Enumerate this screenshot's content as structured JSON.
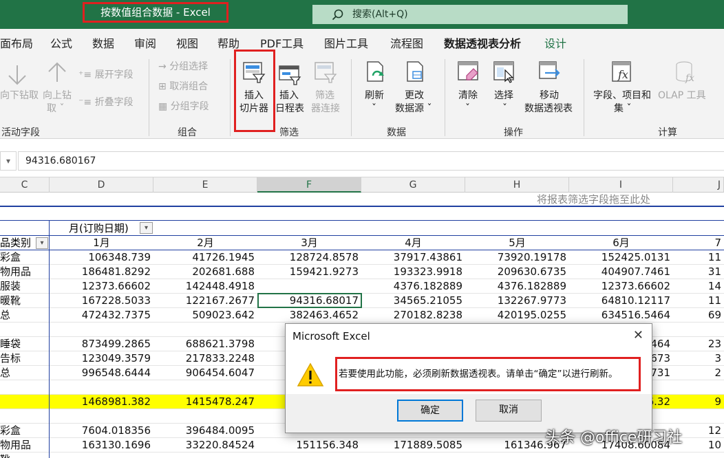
{
  "title": "按数值组合数据 - Excel",
  "search": {
    "placeholder": "搜索(Alt+Q)"
  },
  "tabs": [
    "面布局",
    "公式",
    "数据",
    "审阅",
    "视图",
    "帮助",
    "PDF工具",
    "图片工具",
    "流程图",
    "数据透视表分析",
    "设计"
  ],
  "ribbon": {
    "drill_down": "向下钻取",
    "drill_up_1": "向上钻",
    "drill_up_2": "取 ˇ",
    "expand_field": "展开字段",
    "collapse_field": "折叠字段",
    "group_active": "活动字段",
    "group_selection": "分组选择",
    "ungroup": "取消组合",
    "group_field": "分组字段",
    "group_group": "组合",
    "insert_slicer_1": "插入",
    "insert_slicer_2": "切片器",
    "insert_timeline_1": "插入",
    "insert_timeline_2": "日程表",
    "filter_conn_1": "筛选",
    "filter_conn_2": "器连接",
    "group_filter": "筛选",
    "refresh_1": "刷新",
    "refresh_2": "ˇ",
    "change_source_1": "更改",
    "change_source_2": "数据源 ˇ",
    "group_data": "数据",
    "clear_1": "清除",
    "clear_2": "ˇ",
    "select_1": "选择",
    "select_2": "ˇ",
    "move_1": "移动",
    "move_2": "数据透视表",
    "group_actions": "操作",
    "fields_1": "字段、项目和",
    "fields_2": "集 ˇ",
    "olap": "OLAP 工具",
    "group_calc": "计算"
  },
  "formula_value": "94316.680167",
  "columns": [
    "C",
    "D",
    "E",
    "F",
    "G",
    "H",
    "I",
    "J"
  ],
  "drop_hint": "将报表筛选字段拖至此处",
  "pivot": {
    "col_field": "月(订购日期)",
    "row_field": "品类别",
    "months": [
      "1月",
      "2月",
      "3月",
      "4月",
      "5月",
      "6月",
      "7"
    ],
    "rows": [
      {
        "label": "彩盒",
        "vals": [
          "106348.739",
          "41726.1945",
          "128724.8578",
          "37917.43861",
          "73920.19178",
          "152425.0131",
          "11"
        ]
      },
      {
        "label": "物用品",
        "vals": [
          "186481.8292",
          "202681.688",
          "159421.9273",
          "193323.9918",
          "209630.6735",
          "404907.7461",
          "31"
        ]
      },
      {
        "label": "服装",
        "vals": [
          "12373.66602",
          "142448.4918",
          "",
          "4376.182889",
          "4376.182889",
          "12373.66602",
          "14"
        ]
      },
      {
        "label": "暖靴",
        "vals": [
          "167228.5033",
          "122167.2677",
          "94316.68017",
          "34565.21055",
          "132267.9773",
          "64810.12117",
          "11"
        ]
      },
      {
        "label": "总",
        "vals": [
          "472432.7375",
          "509023.642",
          "382463.4652",
          "270182.8238",
          "420195.0255",
          "634516.5464",
          "69"
        ]
      },
      {
        "label": "",
        "vals": [
          "",
          "",
          "",
          "",
          "",
          "",
          ""
        ]
      },
      {
        "label": "睡袋",
        "vals": [
          "873499.2865",
          "688621.3798",
          "",
          "",
          "",
          "464",
          "23"
        ]
      },
      {
        "label": "告标",
        "vals": [
          "123049.3579",
          "217833.2248",
          "",
          "",
          "",
          "673",
          "3"
        ]
      },
      {
        "label": "总",
        "vals": [
          "996548.6444",
          "906454.6047",
          "",
          "",
          "",
          "731",
          "2"
        ]
      },
      {
        "label": "",
        "vals": [
          "",
          "",
          "",
          "",
          "",
          "",
          ""
        ]
      },
      {
        "label": "",
        "vals": [
          "1468981.382",
          "1415478.247",
          "",
          "",
          "",
          "6.32",
          "9"
        ]
      },
      {
        "label": "",
        "vals": [
          "",
          "",
          "",
          "",
          "",
          "",
          ""
        ]
      },
      {
        "label": "彩盒",
        "vals": [
          "7604.018356",
          "396484.0095",
          "",
          "",
          "",
          "",
          "12"
        ]
      },
      {
        "label": "物用品",
        "vals": [
          "163130.1696",
          "33220.84524",
          "151156.348",
          "171889.5085",
          "161346.967",
          "17408.60084",
          "10"
        ]
      },
      {
        "label": "靴",
        "vals": [
          "",
          "",
          "",
          "",
          "",
          "",
          ""
        ]
      }
    ]
  },
  "dialog": {
    "title": "Microsoft Excel",
    "message": "若要使用此功能，必须刷新数据透视表。请单击“确定”以进行刷新。",
    "ok": "确定",
    "cancel": "取消"
  },
  "watermark": "头条 @office研习社"
}
